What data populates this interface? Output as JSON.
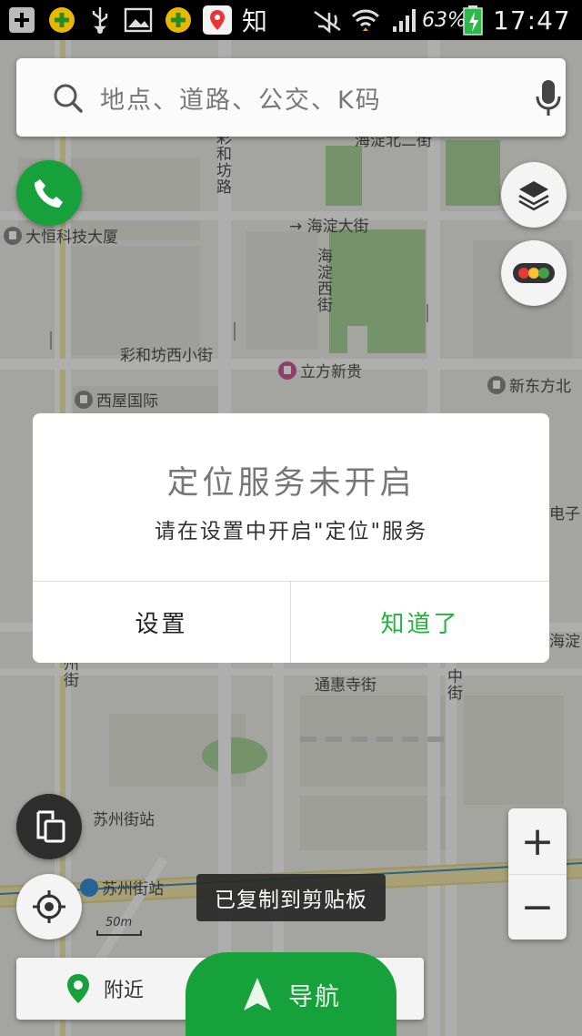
{
  "status_bar": {
    "app_text": "知",
    "battery": "63%",
    "time": "17:47"
  },
  "search": {
    "placeholder": "地点、道路、公交、K码"
  },
  "map": {
    "labels": {
      "caihefang_road": "彩和坊路",
      "haidian_street": "→ 海淀大街",
      "haidian_west_street": "海淀西街",
      "daheng_building": "大恒科技大厦",
      "caihefang_west_alley": "彩和坊西小街",
      "lifang_xingui": "立方新贵",
      "xinwuyuan_north": "新东方北",
      "xiwu_intl": "西屋国际",
      "dianzi": "电子",
      "haidian_edge": "海淀",
      "suzhou_street": "州街",
      "tonghui_temple": "通惠寺街",
      "zhong_street": "中街",
      "suzhou_station_a": "苏州街站",
      "suzhou_station_b": "苏州街站",
      "haidian_north_top": "海淀北二街"
    }
  },
  "dialog": {
    "title": "定位服务未开启",
    "message": "请在设置中开启\"定位\"服务",
    "settings_label": "设置",
    "ok_label": "知道了"
  },
  "scale": "50m",
  "toast": "已复制到剪贴板",
  "bottom": {
    "nearby_label": "附近",
    "nav_label": "导航"
  },
  "zoom": {
    "in_label": "+",
    "out_label": "−"
  },
  "colors": {
    "brand_green": "#16a13a",
    "dialog_ok": "#22b33c",
    "park": "#a6d39a"
  }
}
